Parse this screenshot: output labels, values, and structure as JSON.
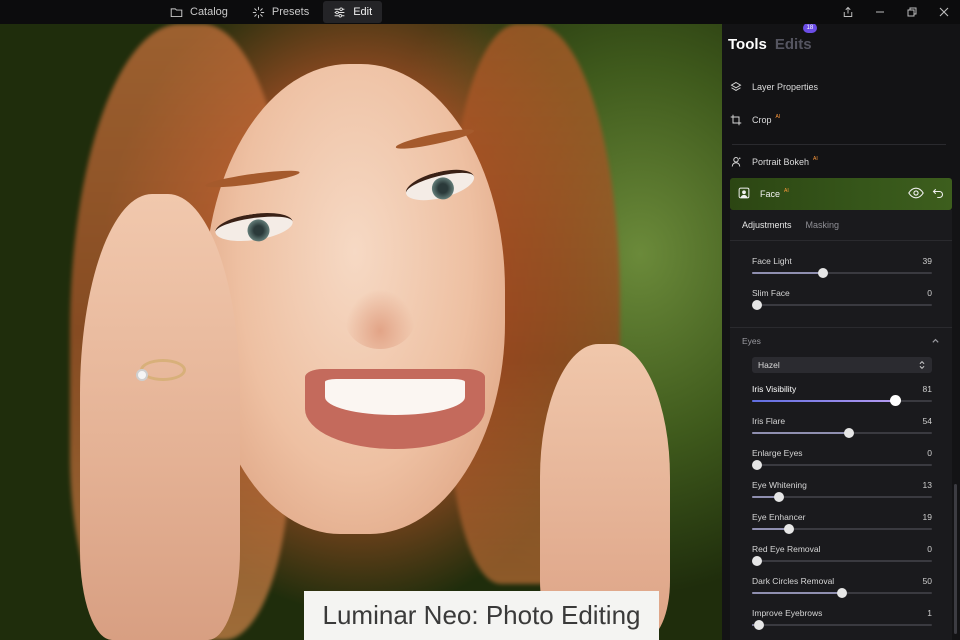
{
  "topnav": {
    "catalog": "Catalog",
    "presets": "Presets",
    "edit": "Edit"
  },
  "caption": "Luminar Neo: Photo Editing",
  "panel": {
    "tab_tools": "Tools",
    "tab_edits": "Edits",
    "edits_count": "18",
    "tools": [
      {
        "label": "Layer Properties",
        "ai": ""
      },
      {
        "label": "Crop",
        "ai": "AI"
      },
      {
        "label": "Portrait Bokeh",
        "ai": "AI"
      }
    ],
    "face": {
      "label": "Face",
      "ai": "AI",
      "subtabs": [
        "Adjustments",
        "Masking"
      ],
      "sliders": [
        {
          "label": "Face Light",
          "value": 39
        },
        {
          "label": "Slim Face",
          "value": 0
        }
      ],
      "eyes": {
        "title": "Eyes",
        "select_value": "Hazel",
        "sliders": [
          {
            "label": "Iris Visibility",
            "value": 81
          },
          {
            "label": "Iris Flare",
            "value": 54
          },
          {
            "label": "Enlarge Eyes",
            "value": 0
          },
          {
            "label": "Eye Whitening",
            "value": 13
          },
          {
            "label": "Eye Enhancer",
            "value": 19
          },
          {
            "label": "Red Eye Removal",
            "value": 0
          },
          {
            "label": "Dark Circles Removal",
            "value": 50
          },
          {
            "label": "Improve Eyebrows",
            "value": 1
          }
        ]
      }
    }
  },
  "colors": {
    "accent": "#6b4de6",
    "face_header": "#36561a",
    "ai_tag": "#ff9a3c"
  }
}
